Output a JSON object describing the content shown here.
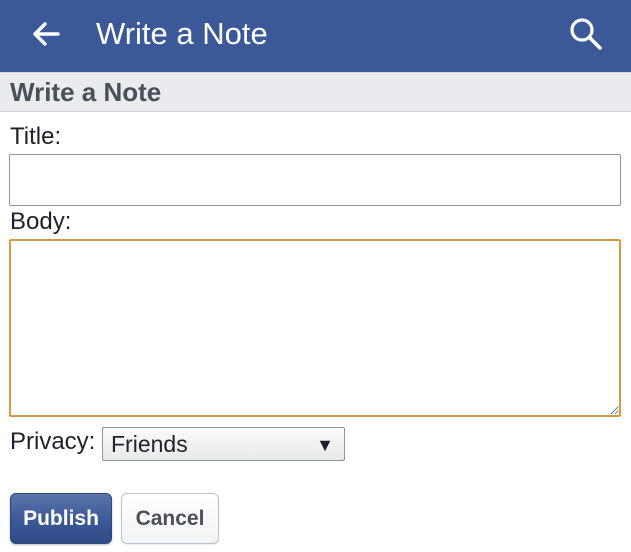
{
  "appbar": {
    "title": "Write a Note",
    "back_icon": "arrow-left-icon",
    "search_icon": "search-icon",
    "color": "#3b5998"
  },
  "section_header": "Write a Note",
  "form": {
    "title_label": "Title:",
    "title_value": "",
    "body_label": "Body:",
    "body_value": "",
    "privacy_label": "Privacy:",
    "privacy_selected": "Friends",
    "privacy_caret": "▼"
  },
  "actions": {
    "publish_label": "Publish",
    "cancel_label": "Cancel"
  }
}
